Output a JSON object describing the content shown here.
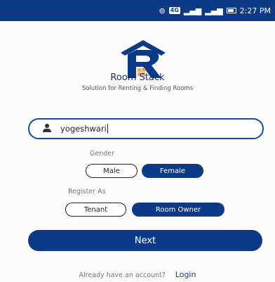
{
  "status_bar": {
    "time": "2:27 PM",
    "network": "4G",
    "colors": {
      "background": "#0d3a86"
    }
  },
  "app": {
    "brand_name": "Room Stack",
    "tagline": "Solution for Renting & Finding Rooms",
    "logo_letter": "R",
    "colors": {
      "primary": "#0d3a86",
      "accent": "#f3a63b"
    }
  },
  "form": {
    "name_value": "yogeshwari",
    "name_icon": "person-icon",
    "gender": {
      "label": "Gender",
      "options": [
        "Male",
        "Female"
      ],
      "selected": "Female"
    },
    "register_as": {
      "label": "Register As",
      "options": [
        "Tenant",
        "Room Owner"
      ],
      "selected": "Room Owner"
    },
    "next_label": "Next"
  },
  "footer": {
    "prompt": "Already have an account?",
    "login_label": "Login"
  }
}
